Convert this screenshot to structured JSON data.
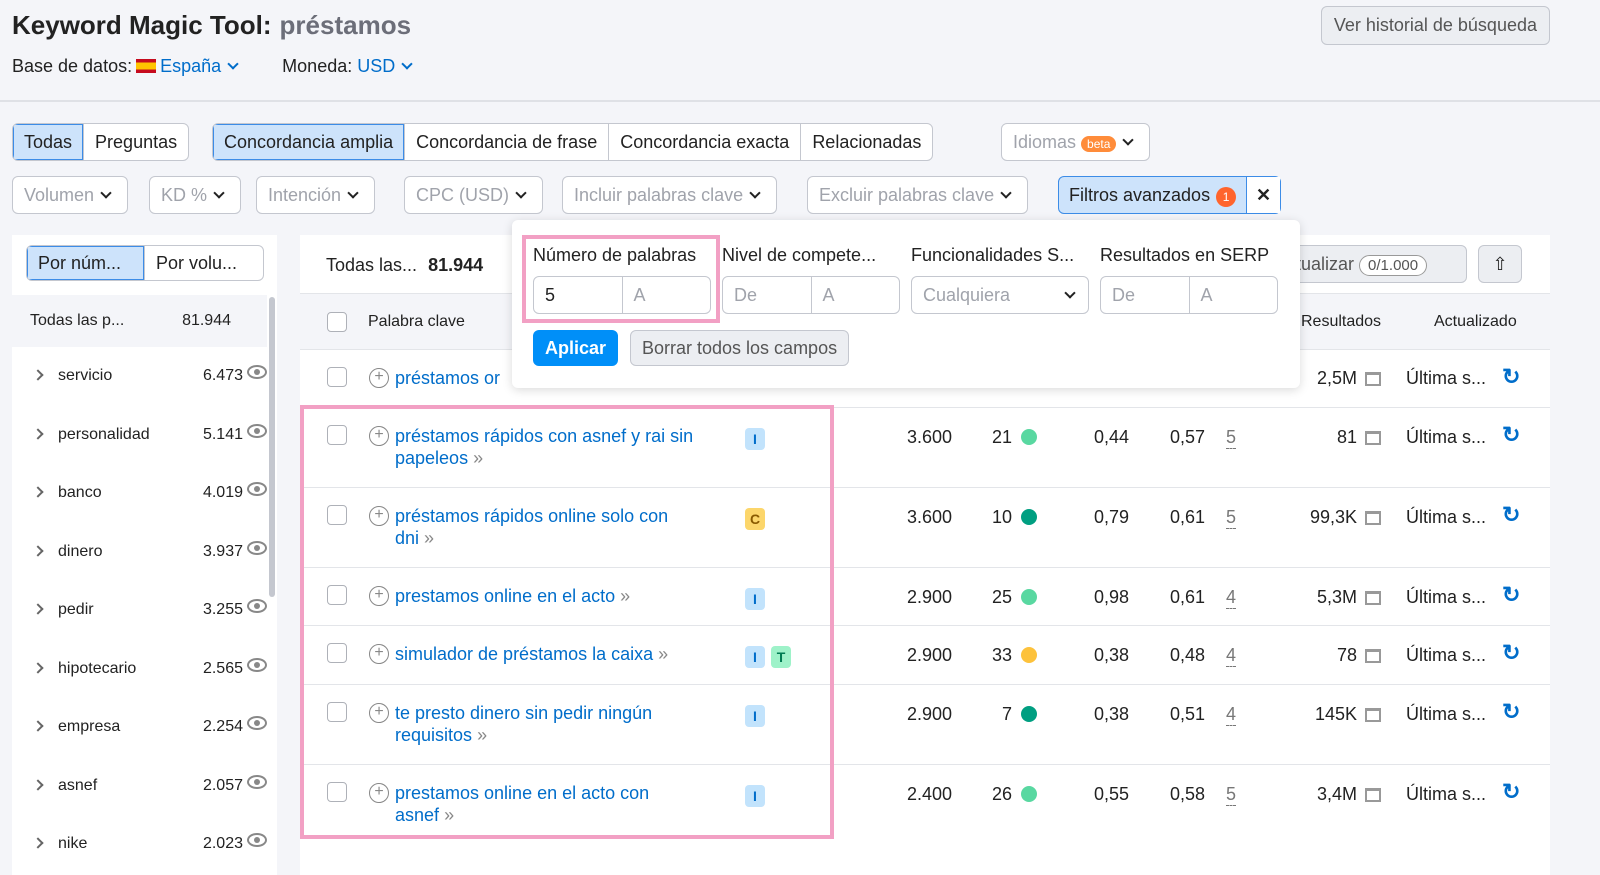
{
  "header": {
    "title": "Keyword Magic Tool:",
    "query": "préstamos",
    "db_label": "Base de datos:",
    "db_value": "España",
    "currency_label": "Moneda:",
    "currency_value": "USD",
    "history_button": "Ver historial de búsqueda"
  },
  "tabs1": [
    "Todas",
    "Preguntas"
  ],
  "tabs2": [
    "Concordancia amplia",
    "Concordancia de frase",
    "Concordancia exacta",
    "Relacionadas"
  ],
  "languages": {
    "label": "Idiomas",
    "badge": "beta"
  },
  "filters": [
    "Volumen",
    "KD %",
    "Intención",
    "CPC (USD)",
    "Incluir palabras clave",
    "Excluir palabras clave"
  ],
  "advanced": {
    "label": "Filtros avanzados",
    "count": "1"
  },
  "sidebar": {
    "toggle": [
      "Por núm...",
      "Por volu..."
    ],
    "all_label": "Todas las p...",
    "all_count": "81.944",
    "items": [
      {
        "name": "servicio",
        "count": "6.473"
      },
      {
        "name": "personalidad",
        "count": "5.141"
      },
      {
        "name": "banco",
        "count": "4.019"
      },
      {
        "name": "dinero",
        "count": "3.937"
      },
      {
        "name": "pedir",
        "count": "3.255"
      },
      {
        "name": "hipotecario",
        "count": "2.565"
      },
      {
        "name": "empresa",
        "count": "2.254"
      },
      {
        "name": "asnef",
        "count": "2.057"
      },
      {
        "name": "nike",
        "count": "2.023"
      }
    ]
  },
  "table": {
    "summary_label": "Todas las...",
    "summary_count": "81.944",
    "update_label": "tualizar",
    "update_count": "0/1.000",
    "headers": {
      "keyword": "Palabra clave",
      "results": "Resultados",
      "updated": "Actualizado"
    },
    "first_row": {
      "keyword": "préstamos or",
      "results": "2,5M",
      "updated": "Última s..."
    },
    "rows": [
      {
        "keyword": "préstamos rápidos con asnef y rai sin",
        "keyword2": "papeleos",
        "intents": [
          "I"
        ],
        "volume": "3.600",
        "kd": "21",
        "kd_color": "#59d8a1",
        "cpc": "0,44",
        "com": "0,57",
        "serp": "5",
        "results": "81",
        "updated": "Última s..."
      },
      {
        "keyword": "préstamos rápidos online solo con",
        "keyword2": "dni",
        "intents": [
          "C"
        ],
        "volume": "3.600",
        "kd": "10",
        "kd_color": "#009f81",
        "cpc": "0,79",
        "com": "0,61",
        "serp": "5",
        "results": "99,3K",
        "updated": "Última s..."
      },
      {
        "keyword": "prestamos online en el acto",
        "keyword2": "",
        "intents": [
          "I"
        ],
        "volume": "2.900",
        "kd": "25",
        "kd_color": "#59d8a1",
        "cpc": "0,98",
        "com": "0,61",
        "serp": "4",
        "results": "5,3M",
        "updated": "Última s..."
      },
      {
        "keyword": "simulador de préstamos la caixa",
        "keyword2": "",
        "intents": [
          "I",
          "T"
        ],
        "volume": "2.900",
        "kd": "33",
        "kd_color": "#fdc23c",
        "cpc": "0,38",
        "com": "0,48",
        "serp": "4",
        "results": "78",
        "updated": "Última s..."
      },
      {
        "keyword": "te presto dinero sin pedir ningún",
        "keyword2": "requisitos",
        "intents": [
          "I"
        ],
        "volume": "2.900",
        "kd": "7",
        "kd_color": "#009f81",
        "cpc": "0,38",
        "com": "0,51",
        "serp": "4",
        "results": "145K",
        "updated": "Última s..."
      },
      {
        "keyword": "prestamos online en el acto con",
        "keyword2": "asnef",
        "intents": [
          "I"
        ],
        "volume": "2.400",
        "kd": "26",
        "kd_color": "#59d8a1",
        "cpc": "0,55",
        "com": "0,58",
        "serp": "5",
        "results": "3,4M",
        "updated": "Última s..."
      }
    ]
  },
  "popup": {
    "cols": [
      "Número de palabras",
      "Nivel de compete...",
      "Funcionalidades S...",
      "Resultados en SERP"
    ],
    "words_from": "5",
    "to_ph": "A",
    "from_ph": "De",
    "any": "Cualquiera",
    "apply": "Aplicar",
    "clear": "Borrar todos los campos"
  }
}
